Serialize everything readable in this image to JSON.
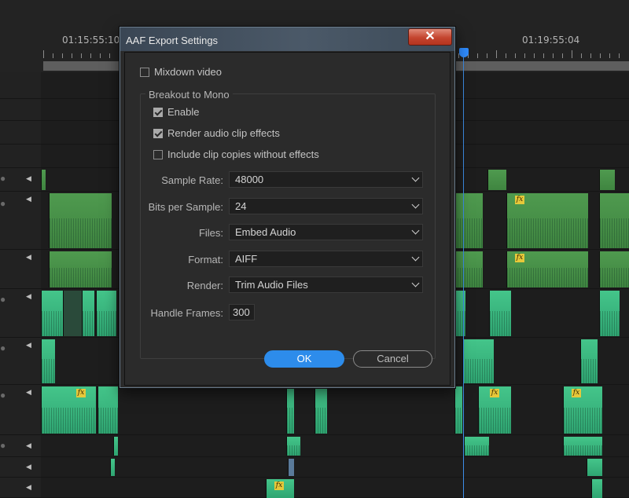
{
  "timeline": {
    "timecodes": [
      "01:15:55:10",
      "01:19:55:04"
    ],
    "fx_badge": "fx"
  },
  "dialog": {
    "title": "AAF Export Settings",
    "close_icon": "close-icon",
    "mixdown_video": {
      "label": "Mixdown video",
      "checked": false
    },
    "breakout_group_label": "Breakout to Mono",
    "enable": {
      "label": "Enable",
      "checked": true
    },
    "render_audio_clip_effects": {
      "label": "Render audio clip effects",
      "checked": true
    },
    "include_clip_copies": {
      "label": "Include clip copies without effects",
      "checked": false
    },
    "sample_rate": {
      "label": "Sample Rate:",
      "value": "48000"
    },
    "bits_per_sample": {
      "label": "Bits per Sample:",
      "value": "24"
    },
    "files": {
      "label": "Files:",
      "value": "Embed Audio"
    },
    "format": {
      "label": "Format:",
      "value": "AIFF"
    },
    "render": {
      "label": "Render:",
      "value": "Trim Audio Files"
    },
    "handle_frames": {
      "label": "Handle Frames:",
      "value": "300"
    },
    "ok_label": "OK",
    "cancel_label": "Cancel"
  },
  "colors": {
    "accent": "#2d8ceb",
    "video_clip": "#4f9a4f",
    "audio_clip": "#44c58a",
    "fx_badge": "#e6c83a"
  }
}
